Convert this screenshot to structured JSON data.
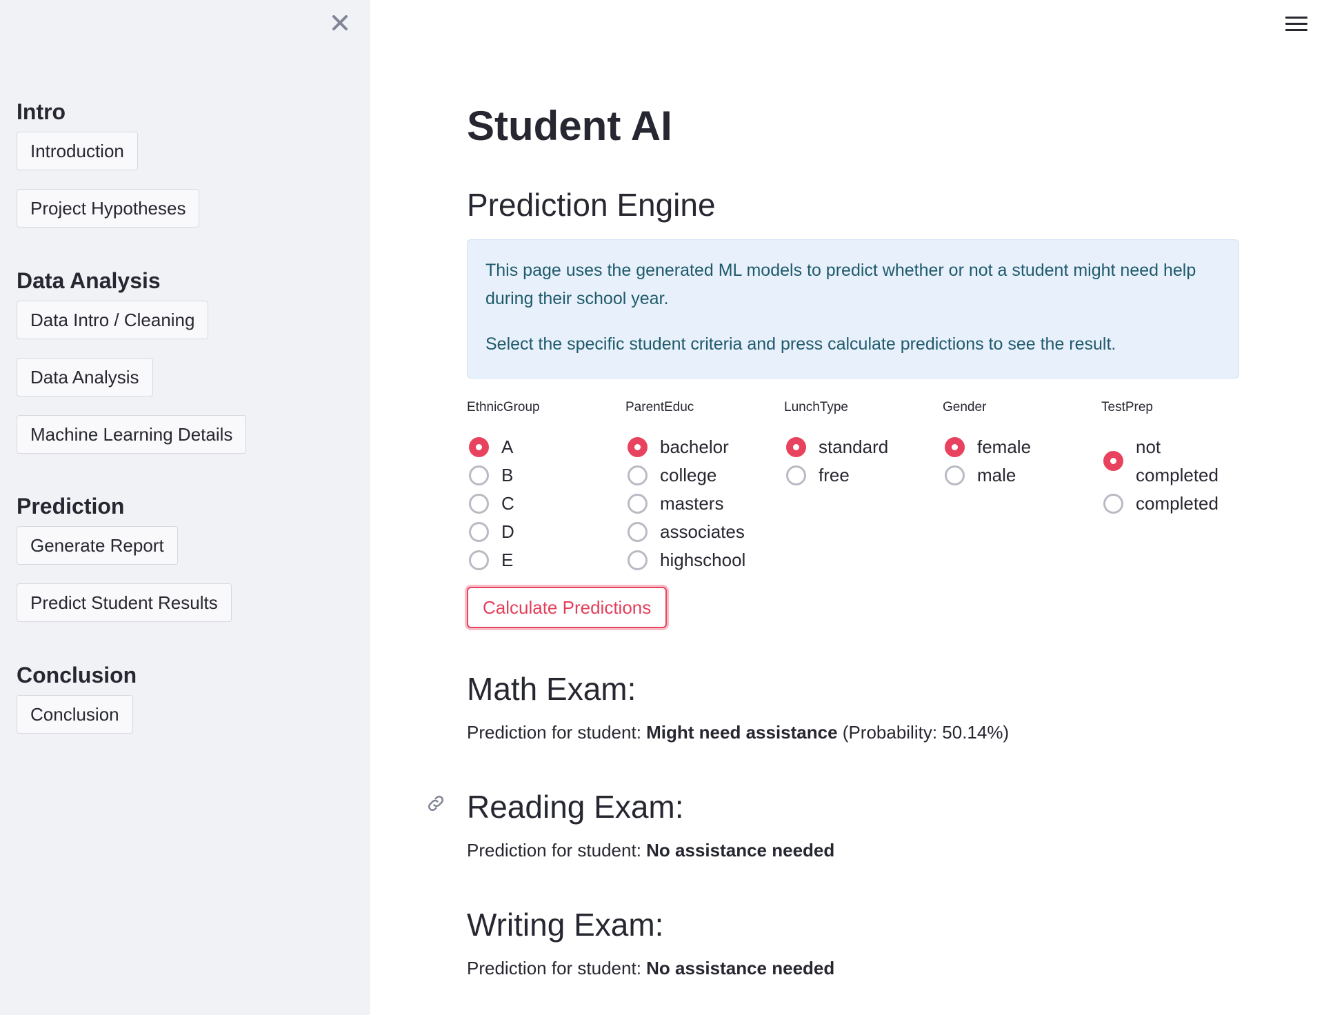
{
  "sidebar": {
    "sections": [
      {
        "heading": "Intro",
        "items": [
          "Introduction",
          "Project Hypotheses"
        ]
      },
      {
        "heading": "Data Analysis",
        "items": [
          "Data Intro / Cleaning",
          "Data Analysis",
          "Machine Learning Details"
        ]
      },
      {
        "heading": "Prediction",
        "items": [
          "Generate Report",
          "Predict Student Results"
        ]
      },
      {
        "heading": "Conclusion",
        "items": [
          "Conclusion"
        ]
      }
    ],
    "close_icon": "close-icon"
  },
  "header": {
    "menu_icon": "hamburger-menu-icon"
  },
  "main": {
    "title": "Student AI",
    "subtitle": "Prediction Engine",
    "info": {
      "line1": "This page uses the generated ML models to predict whether or not a student might need help during their school year.",
      "line2": "Select the specific student criteria and press calculate predictions to see the result."
    },
    "groups": [
      {
        "label": "EthnicGroup",
        "options": [
          "A",
          "B",
          "C",
          "D",
          "E"
        ],
        "selected": "A"
      },
      {
        "label": "ParentEduc",
        "options": [
          "bachelor",
          "college",
          "masters",
          "associates",
          "highschool"
        ],
        "selected": "bachelor"
      },
      {
        "label": "LunchType",
        "options": [
          "standard",
          "free"
        ],
        "selected": "standard"
      },
      {
        "label": "Gender",
        "options": [
          "female",
          "male"
        ],
        "selected": "female"
      },
      {
        "label": "TestPrep",
        "options": [
          "not completed",
          "completed"
        ],
        "selected": "not completed"
      }
    ],
    "calc_button": "Calculate Predictions",
    "results": {
      "math": {
        "heading": "Math Exam:",
        "prefix": "Prediction for student: ",
        "result": "Might need assistance",
        "suffix": " (Probability: 50.14%)"
      },
      "reading": {
        "heading": "Reading Exam:",
        "prefix": "Prediction for student: ",
        "result": "No assistance needed"
      },
      "writing": {
        "heading": "Writing Exam:",
        "prefix": "Prediction for student: ",
        "result": "No assistance needed"
      }
    }
  },
  "colors": {
    "accent": "#e8435e",
    "sidebar_bg": "#f0f2f6",
    "info_bg": "#e7f0fb",
    "info_text": "#1f5a6b"
  }
}
